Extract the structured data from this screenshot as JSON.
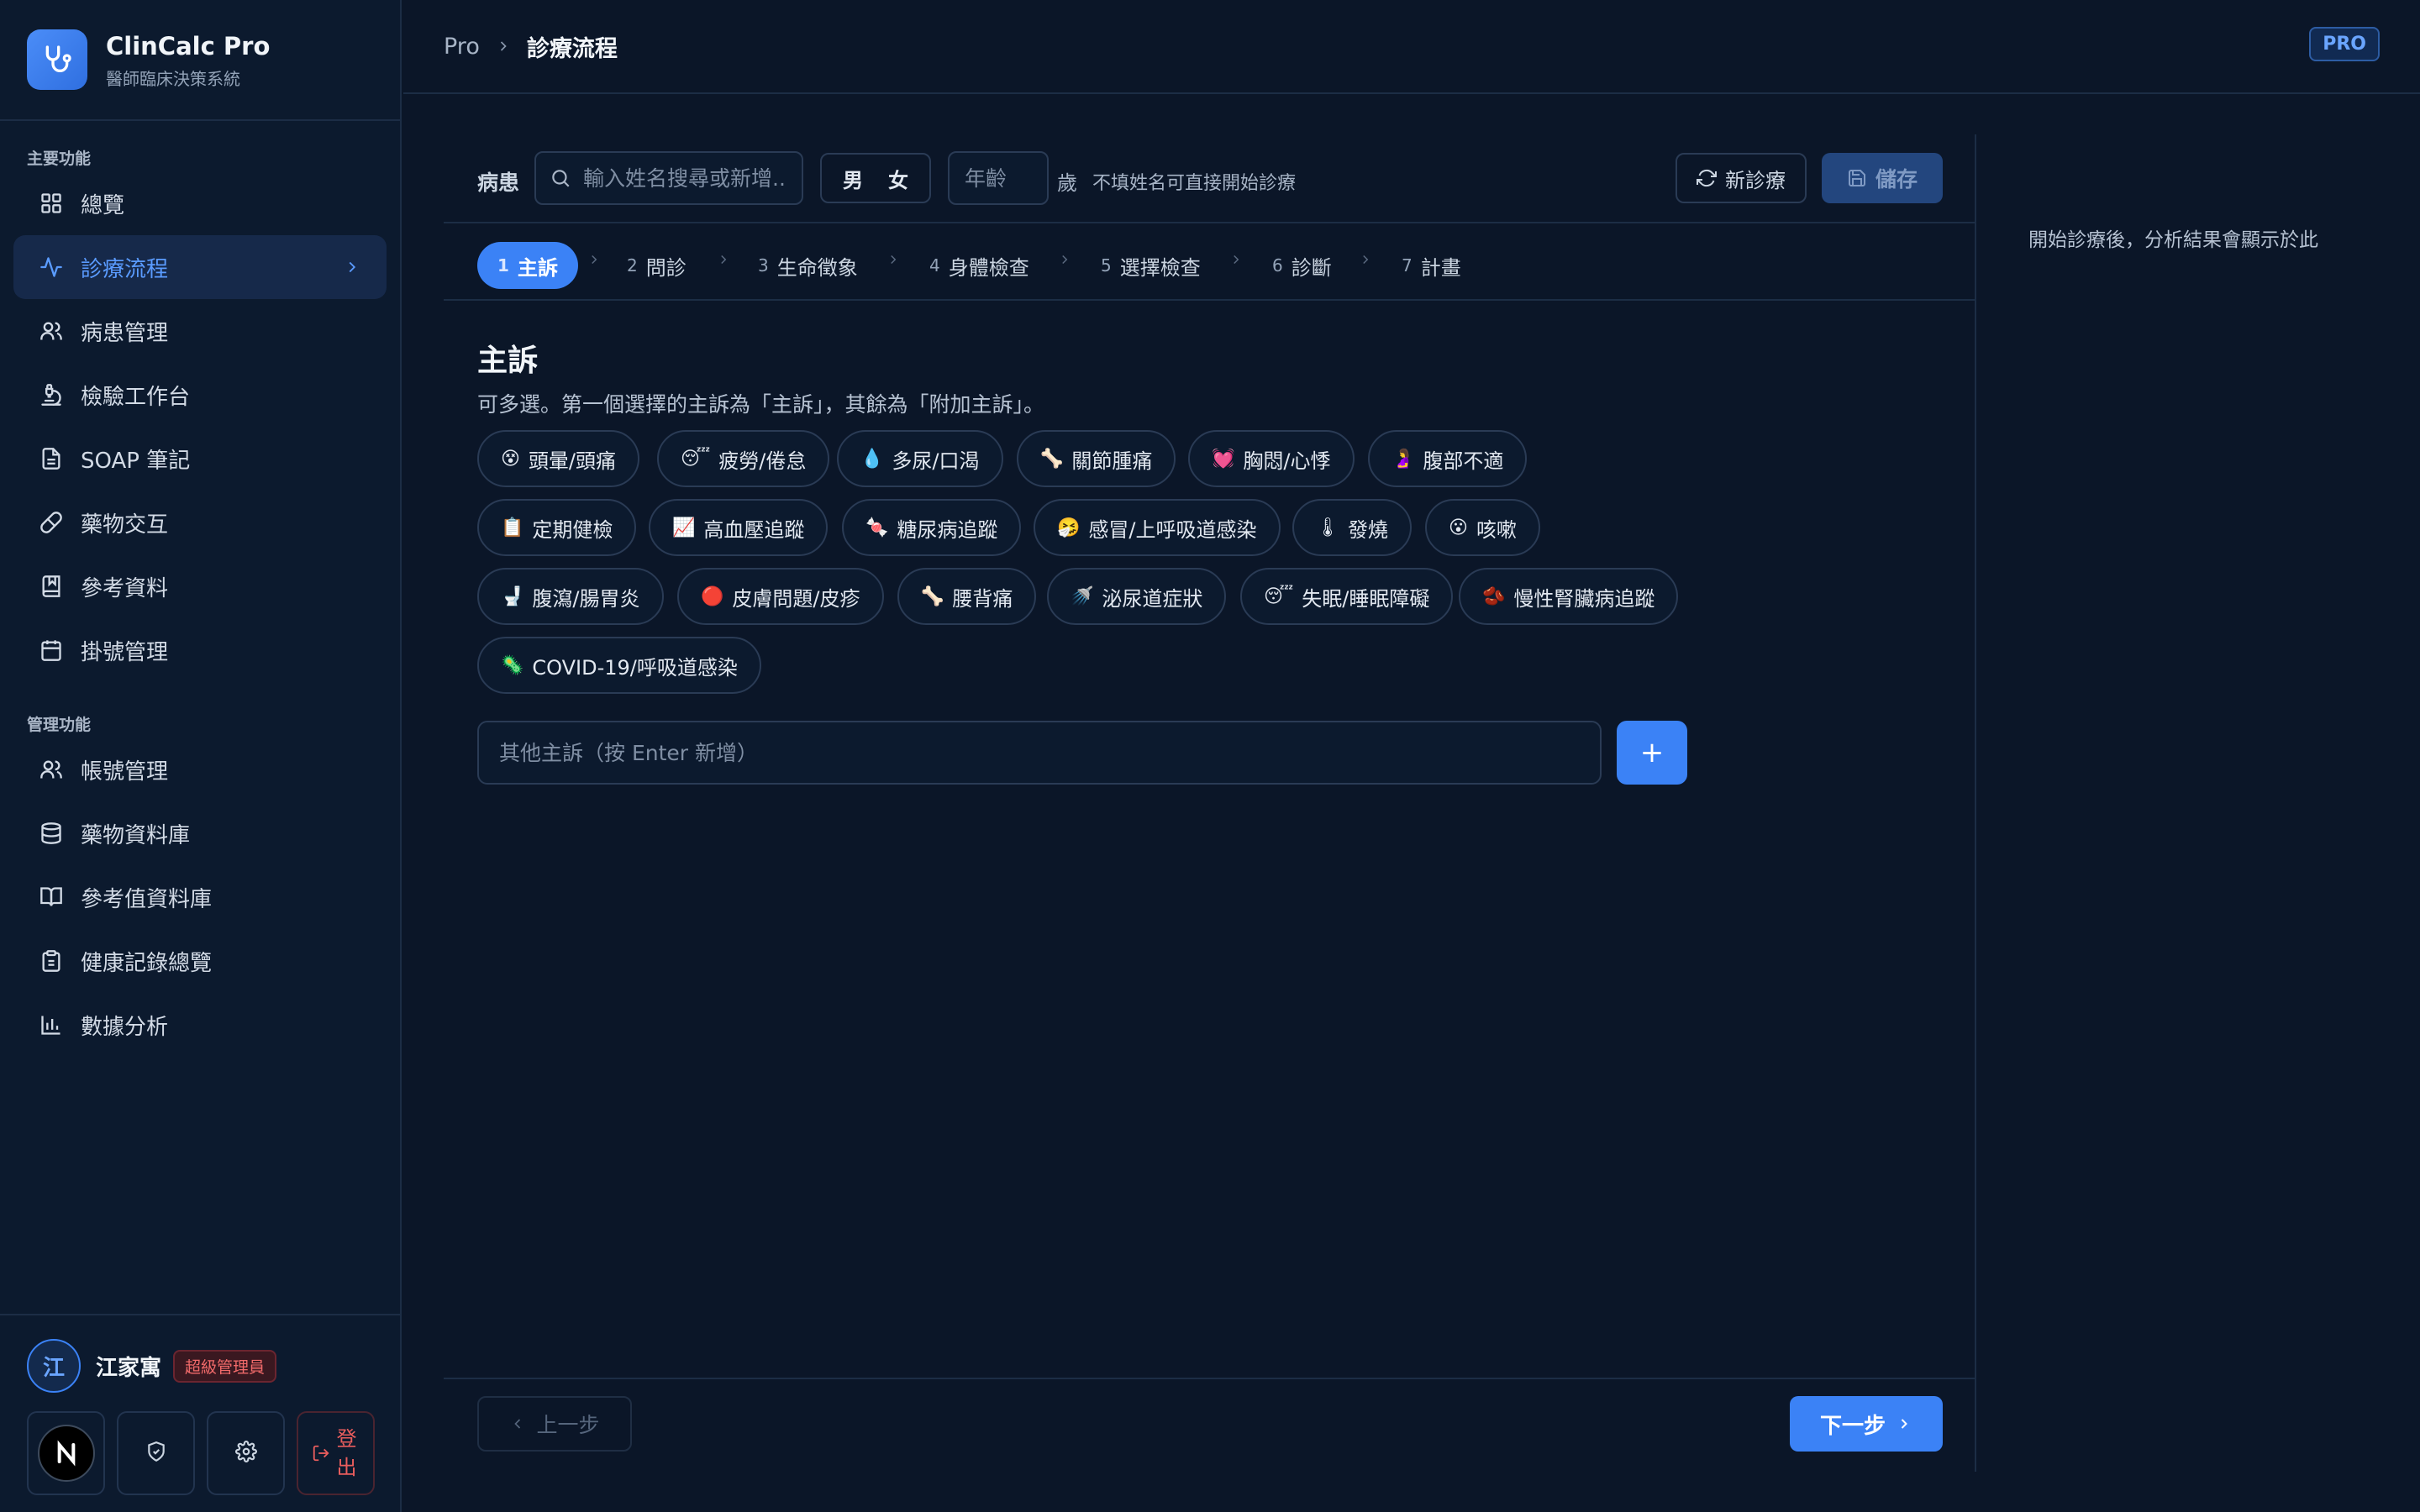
{
  "brand": {
    "title": "ClinCalc Pro",
    "subtitle": "醫師臨床決策系統"
  },
  "sidebar": {
    "section_main": "主要功能",
    "section_admin": "管理功能",
    "main_items": [
      {
        "label": "總覽",
        "icon": "grid-icon"
      },
      {
        "label": "診療流程",
        "icon": "activity-icon",
        "active": true
      },
      {
        "label": "病患管理",
        "icon": "users-icon"
      },
      {
        "label": "檢驗工作台",
        "icon": "microscope-icon"
      },
      {
        "label": "SOAP 筆記",
        "icon": "file-text-icon"
      },
      {
        "label": "藥物交互",
        "icon": "pill-icon"
      },
      {
        "label": "參考資料",
        "icon": "book-bookmark-icon"
      },
      {
        "label": "掛號管理",
        "icon": "calendar-icon"
      }
    ],
    "admin_items": [
      {
        "label": "帳號管理",
        "icon": "users-icon"
      },
      {
        "label": "藥物資料庫",
        "icon": "database-icon"
      },
      {
        "label": "參考值資料庫",
        "icon": "book-open-icon"
      },
      {
        "label": "健康記錄總覽",
        "icon": "clipboard-icon"
      },
      {
        "label": "數據分析",
        "icon": "bar-chart-icon"
      }
    ]
  },
  "user": {
    "avatar_letter": "江",
    "name": "江家寓",
    "role": "超級管理員",
    "logout_label": "登出"
  },
  "topbar": {
    "breadcrumb_root": "Pro",
    "breadcrumb_current": "診療流程",
    "badge": "PRO"
  },
  "patient": {
    "label": "病患",
    "search_placeholder": "輸入姓名搜尋或新增...",
    "sex_male": "男",
    "sex_female": "女",
    "age_placeholder": "年齡",
    "age_unit": "歲",
    "hint": "不填姓名可直接開始診療",
    "new_label": "新診療",
    "save_label": "儲存"
  },
  "steps": [
    {
      "num": "1",
      "label": "主訴",
      "active": true
    },
    {
      "num": "2",
      "label": "問診"
    },
    {
      "num": "3",
      "label": "生命徵象"
    },
    {
      "num": "4",
      "label": "身體檢查"
    },
    {
      "num": "5",
      "label": "選擇檢查"
    },
    {
      "num": "6",
      "label": "診斷"
    },
    {
      "num": "7",
      "label": "計畫"
    }
  ],
  "complaint": {
    "title": "主訴",
    "description": "可多選。第一個選擇的主訴為「主訴」，其餘為「附加主訴」。",
    "chips": [
      {
        "emoji": "😵",
        "label": "頭暈/頭痛"
      },
      {
        "emoji": "😴",
        "label": "疲勞/倦怠"
      },
      {
        "emoji": "💧",
        "label": "多尿/口渴"
      },
      {
        "emoji": "🦴",
        "label": "關節腫痛"
      },
      {
        "emoji": "💓",
        "label": "胸悶/心悸"
      },
      {
        "emoji": "🤰",
        "label": "腹部不適"
      },
      {
        "emoji": "📋",
        "label": "定期健檢"
      },
      {
        "emoji": "📈",
        "label": "高血壓追蹤"
      },
      {
        "emoji": "🍬",
        "label": "糖尿病追蹤"
      },
      {
        "emoji": "🤧",
        "label": "感冒/上呼吸道感染"
      },
      {
        "emoji": "🌡",
        "label": "發燒"
      },
      {
        "emoji": "😮",
        "label": "咳嗽"
      },
      {
        "emoji": "🚽",
        "label": "腹瀉/腸胃炎"
      },
      {
        "emoji": "🔴",
        "label": "皮膚問題/皮疹"
      },
      {
        "emoji": "🦴",
        "label": "腰背痛"
      },
      {
        "emoji": "🚿",
        "label": "泌尿道症狀"
      },
      {
        "emoji": "😴",
        "label": "失眠/睡眠障礙"
      },
      {
        "emoji": "🫘",
        "label": "慢性腎臟病追蹤"
      },
      {
        "emoji": "🦠",
        "label": "COVID-19/呼吸道感染"
      }
    ],
    "other_placeholder": "其他主訴（按 Enter 新增）",
    "add_label": "+"
  },
  "footer": {
    "prev_label": "上一步",
    "next_label": "下一步"
  },
  "right_panel": {
    "text": "開始診療後，分析結果會顯示於此"
  },
  "colors": {
    "accent": "#3b82f6",
    "background": "#0b1628",
    "sidebar": "#0c1a2e",
    "danger": "#f16a6a"
  }
}
